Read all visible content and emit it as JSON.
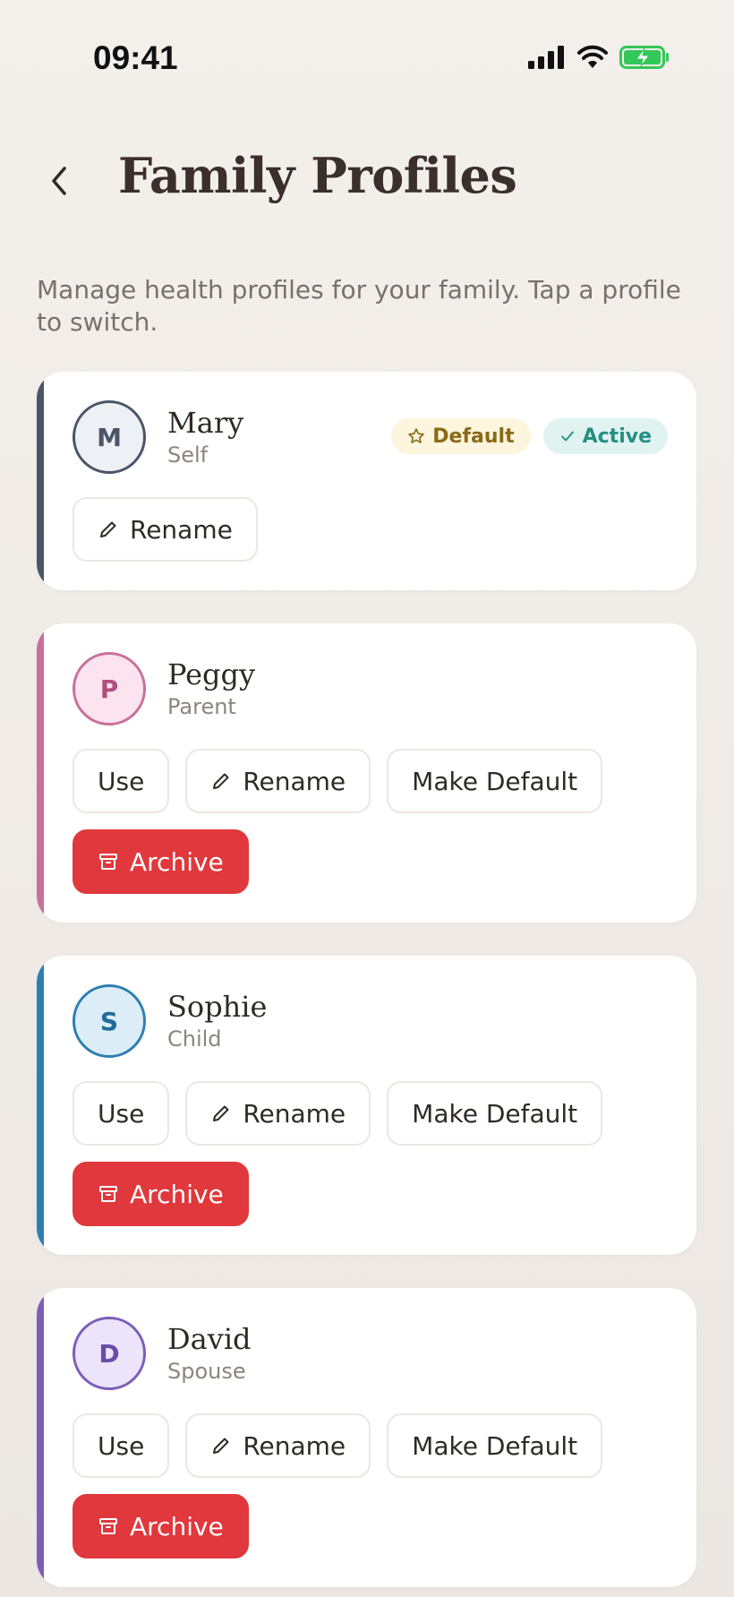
{
  "status_bar": {
    "time": "09:41",
    "icons": [
      "signal-icon",
      "wifi-icon",
      "battery-charging-icon"
    ],
    "battery_color": "#34c759"
  },
  "header": {
    "back_icon": "chevron-left-icon",
    "title": "Family Profiles"
  },
  "subtitle": "Manage health profiles for your family. Tap a profile to switch.",
  "profiles": [
    {
      "initial": "M",
      "name": "Mary",
      "role": "Self",
      "accent": "#4a5568",
      "avatar_bg": "#edf0f4",
      "avatar_fg": "#4a5568",
      "badges": {
        "default": "Default",
        "active": "Active"
      },
      "actions": {
        "rename": "Rename"
      }
    },
    {
      "initial": "P",
      "name": "Peggy",
      "role": "Parent",
      "accent": "#c96f9a",
      "avatar_bg": "#fbe3ef",
      "avatar_fg": "#b0507d",
      "actions": {
        "use": "Use",
        "rename": "Rename",
        "make_default": "Make Default",
        "archive": "Archive"
      }
    },
    {
      "initial": "S",
      "name": "Sophie",
      "role": "Child",
      "accent": "#2d7fb0",
      "avatar_bg": "#dcedf7",
      "avatar_fg": "#1f6c98",
      "actions": {
        "use": "Use",
        "rename": "Rename",
        "make_default": "Make Default",
        "archive": "Archive"
      }
    },
    {
      "initial": "D",
      "name": "David",
      "role": "Spouse",
      "accent": "#7b5fb8",
      "avatar_bg": "#ece4fa",
      "avatar_fg": "#6a4ca8",
      "actions": {
        "use": "Use",
        "rename": "Rename",
        "make_default": "Make Default",
        "archive": "Archive"
      }
    }
  ],
  "colors": {
    "archive": "#e0383c",
    "badge_default": "#8a6a16",
    "badge_active": "#248f82"
  }
}
